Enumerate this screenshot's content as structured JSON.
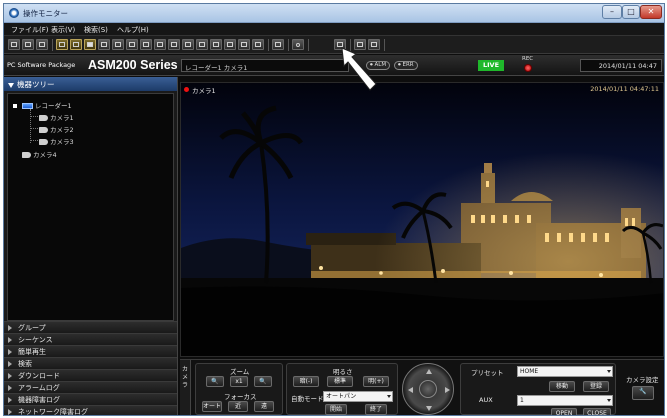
{
  "window": {
    "title": "操作モニター"
  },
  "menu": [
    "ファイル(F)",
    "表示(V)",
    "検索(S)",
    "ヘルプ(H)"
  ],
  "header": {
    "package_label": "PC Software Package",
    "product": "ASM200 Series",
    "camera_selector": "レコーダー1 カメラ1",
    "alm_label": "ALM",
    "err_label": "ERR",
    "live_badge": "LIVE",
    "rec_label": "REC",
    "datetime": "2014/01/11 04:47"
  },
  "sidebar": {
    "tree_title": "機器ツリー",
    "recorder": "レコーダー1",
    "cameras": [
      "カメラ1",
      "カメラ2",
      "カメラ3"
    ],
    "camera4": "カメラ4",
    "sections": [
      "グループ",
      "シーケンス",
      "簡単再生",
      "検索",
      "ダウンロード",
      "アラームログ",
      "機器障害ログ",
      "ネットワーク障害ログ"
    ]
  },
  "video": {
    "camera_label": "カメラ1",
    "timestamp": "2014/01/11 04:47:11"
  },
  "controls": {
    "camera_tab": "カメラ",
    "zoom_label": "ズーム",
    "zoom_mid": "x1",
    "focus_label": "フォーカス",
    "focus_buttons": [
      "オート",
      "近",
      "遠"
    ],
    "brightness_label": "明るさ",
    "brightness_buttons": [
      "暗(-)",
      "標準",
      "明(+)"
    ],
    "auto_mode_label": "自動モード",
    "auto_mode_value": "オートパン",
    "start_button": "開始",
    "end_button": "終了",
    "preset_label": "プリセット",
    "preset_value": "HOME",
    "move_button": "移動",
    "register_button": "登録",
    "aux_label": "AUX",
    "aux_value": "1",
    "open_button": "OPEN",
    "close_button": "CLOSE",
    "camera_settings_label": "カメラ設定"
  }
}
